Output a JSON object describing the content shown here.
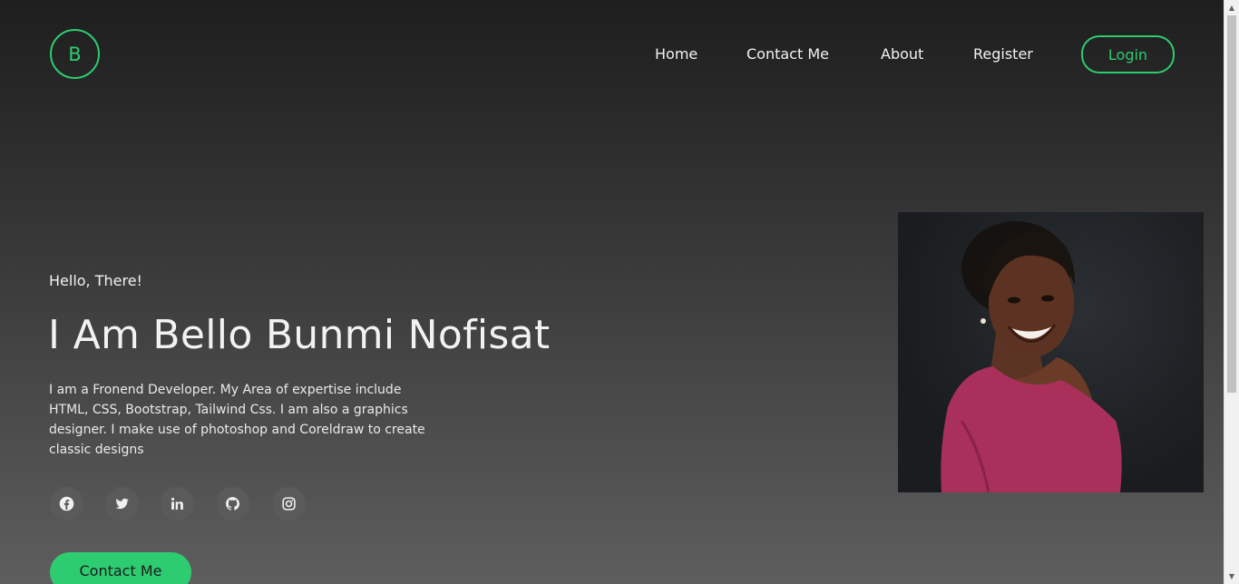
{
  "header": {
    "logo_letter": "B",
    "nav": {
      "home": "Home",
      "contact": "Contact Me",
      "about": "About",
      "register": "Register"
    },
    "login_label": "Login"
  },
  "hero": {
    "greeting": "Hello, There!",
    "title": "I Am Bello Bunmi Nofisat",
    "bio": "I am a Fronend Developer. My Area of expertise include HTML, CSS, Bootstrap, Tailwind Css. I am also a graphics designer. I make use of photoshop and Coreldraw to create classic designs",
    "socials": [
      "facebook-icon",
      "twitter-icon",
      "linkedin-icon",
      "github-icon",
      "instagram-icon"
    ],
    "contact_button": "Contact Me"
  },
  "colors": {
    "accent": "#2ecc71",
    "background_top": "#1e1e1e",
    "background_bottom": "#5e5e5e"
  }
}
